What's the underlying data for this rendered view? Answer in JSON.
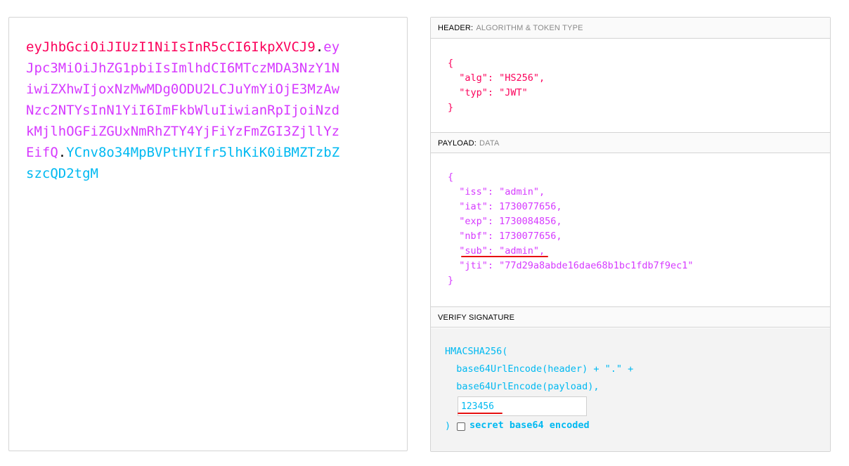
{
  "encoded": {
    "header_lines": [
      "eyJhbGciOiJIUzI1NiIsInR5cCI6IkpXVCJ9"
    ],
    "dot": ".",
    "payload_line1_start": "ey",
    "payload_lines": [
      "Jpc3MiOiJhZG1pbiIsImlhdCI6MTczMDA3NzY1N",
      "iwiZXhwIjoxNzMwMDg0ODU2LCJuYmYiOjE3MzAw",
      "Nzc2NTYsInN1YiI6ImFkbWluIiwianRpIjoiNzd",
      "kMjlhOGFiZGUxNmRhZTY4YjFiYzFmZGI3ZjllYz"
    ],
    "payload_last": "EifQ",
    "sig_part1": "YCnv8o34MpBVPtHYIfr5lhKiK0iBMZTzbZ",
    "sig_part2": "szcQD2tgM"
  },
  "header_section": {
    "label": "HEADER:",
    "sublabel": "ALGORITHM & TOKEN TYPE",
    "lines": [
      "{",
      "  \"alg\": \"HS256\",",
      "  \"typ\": \"JWT\"",
      "}"
    ]
  },
  "payload_section": {
    "label": "PAYLOAD:",
    "sublabel": "DATA",
    "lines": [
      "{",
      "  \"iss\": \"admin\",",
      "  \"iat\": 1730077656,",
      "  \"exp\": 1730084856,",
      "  \"nbf\": 1730077656,",
      "  \"sub\": \"admin\",",
      "  \"jti\": \"77d29a8abde16dae68b1bc1fdb7f9ec1\"",
      "}"
    ]
  },
  "verify_section": {
    "label": "VERIFY SIGNATURE",
    "line1": "HMACSHA256(",
    "line2": "  base64UrlEncode(header) + \".\" +",
    "line3": "  base64UrlEncode(payload),",
    "secret_value": "123456",
    "close": ")",
    "checkbox_label": "secret base64 encoded",
    "checkbox_checked": false
  },
  "colors": {
    "header": "#fb015b",
    "payload": "#d63aff",
    "signature": "#00b9f1",
    "annotation": "#e61010"
  }
}
